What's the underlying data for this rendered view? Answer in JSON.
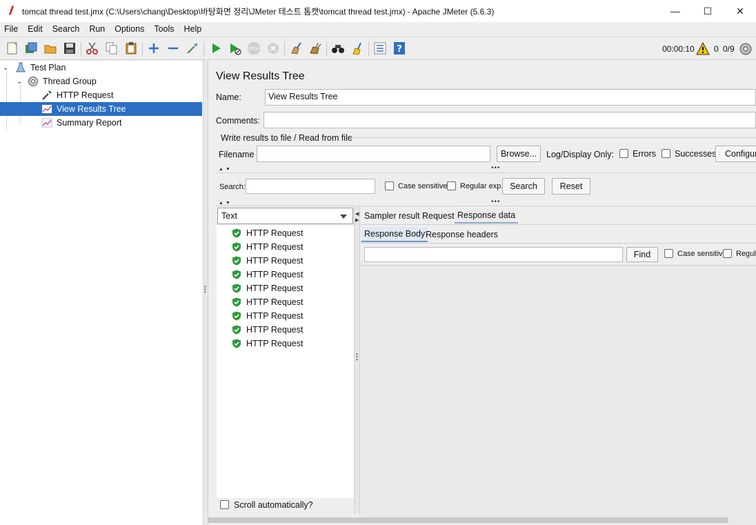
{
  "window": {
    "title": "tomcat thread test.jmx (C:\\Users\\chang\\Desktop\\바탕화면 정리\\JMeter 테스트 톰캣\\tomcat thread test.jmx) - Apache JMeter (5.6.3)",
    "minimize": "—",
    "maximize": "☐",
    "close": "✕"
  },
  "menu": {
    "file": "File",
    "edit": "Edit",
    "search": "Search",
    "run": "Run",
    "options": "Options",
    "tools": "Tools",
    "help": "Help"
  },
  "toolbar": {
    "elapsed": "00:00:10",
    "warnings": "0",
    "threads": "0/9"
  },
  "tree": {
    "items": [
      {
        "label": "Test Plan",
        "icon": "test-plan-icon"
      },
      {
        "label": "Thread Group",
        "icon": "gear-icon"
      },
      {
        "label": "HTTP Request",
        "icon": "pipette-icon"
      },
      {
        "label": "View Results Tree",
        "icon": "chart-icon",
        "selected": true
      },
      {
        "label": "Summary Report",
        "icon": "chart-icon"
      }
    ]
  },
  "panel": {
    "title": "View Results Tree",
    "name_label": "Name:",
    "name_value": "View Results Tree",
    "comments_label": "Comments:",
    "comments_value": "",
    "file_section": "Write results to file / Read from file",
    "filename_label": "Filename",
    "filename_value": "",
    "browse": "Browse...",
    "log_display": "Log/Display Only:",
    "errors": "Errors",
    "successes": "Successes",
    "configure": "Configure",
    "search_label": "Search:",
    "search_value": "",
    "case_sensitive": "Case sensitive",
    "regular_exp": "Regular exp.",
    "search_btn": "Search",
    "reset_btn": "Reset"
  },
  "results": {
    "renderer": "Text",
    "items": [
      "HTTP Request",
      "HTTP Request",
      "HTTP Request",
      "HTTP Request",
      "HTTP Request",
      "HTTP Request",
      "HTTP Request",
      "HTTP Request",
      "HTTP Request"
    ],
    "scroll_auto": "Scroll automatically?"
  },
  "detail": {
    "tabs": [
      "Sampler result",
      "Request",
      "Response data"
    ],
    "subtabs": [
      "Response Body",
      "Response headers"
    ],
    "find_value": "",
    "find_btn": "Find",
    "case_sensitive": "Case sensitive",
    "regular": "Regular exp."
  }
}
